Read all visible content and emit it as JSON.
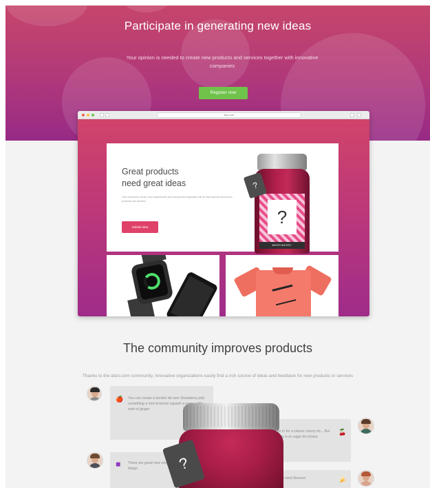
{
  "hero": {
    "title": "Participate in generating new ideas",
    "subtitle": "Your opinion is needed to create new products and services together with innovative companies",
    "register_label": "Register now",
    "register_color": "#6fc24a",
    "gradient_colors": [
      "#c6466b",
      "#972a86"
    ]
  },
  "browser": {
    "url": "atizo.com",
    "card": {
      "title_line1": "Great products",
      "title_line2": "need great ideas",
      "description": "Your customers needs, new requirements and unexpected inspiration will all help improve tomorrow's products and services",
      "submit_label": "Submit idea"
    },
    "jar_label": "BERRYBERRY",
    "jar_tag": "?",
    "jar_question": "?"
  },
  "community": {
    "title": "The community improves products",
    "subtitle": "Thanks to the atizo.com community, innovative organizations easily find a rich source of ideas and feedback for new products or services",
    "comments": [
      {
        "icon": "apple-icon",
        "glyph": "🍎",
        "text": "You can create a terrible fat new Strawberry jelly something a hint of lemon squash a even a little mint of ginger"
      },
      {
        "icon": "cherry-icon",
        "glyph": "🍒",
        "text": "I'd go in for a classic cherry tin... But the key is to sugar bit choice."
      },
      {
        "icon": "jar-icon",
        "glyph": "◼",
        "text": "There are great new recipes across for a mood of things"
      },
      {
        "icon": "banana-icon",
        "glyph": "🍌",
        "text": "...of the best flavours"
      }
    ],
    "big_jar_tag": "?"
  }
}
